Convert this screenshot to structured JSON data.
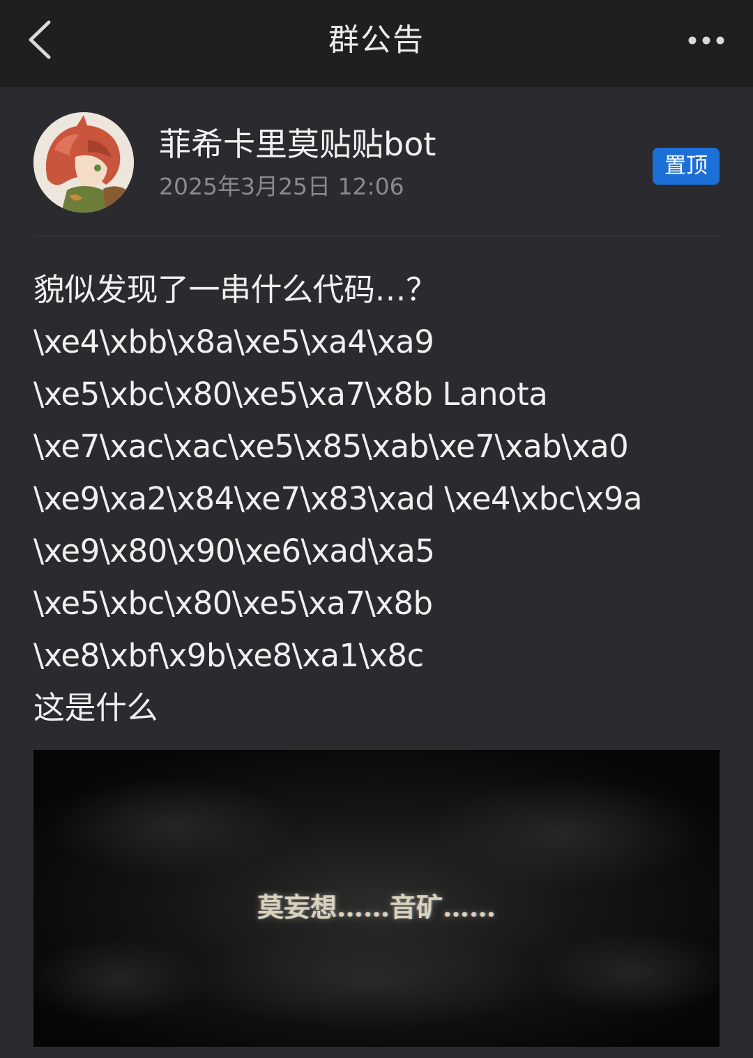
{
  "header": {
    "title": "群公告",
    "back_icon": "chevron-left-icon",
    "more_icon": "more-horizontal-icon"
  },
  "post": {
    "author": "菲希卡里莫贴贴bot",
    "time": "2025年3月25日 12:06",
    "pin_label": "置顶",
    "lines": [
      "貌似发现了一串什么代码…？",
      "\\xe4\\xbb\\x8a\\xe5\\xa4\\xa9",
      "\\xe5\\xbc\\x80\\xe5\\xa7\\x8b Lanota",
      "\\xe7\\xac\\xac\\xe5\\x85\\xab\\xe7\\xab\\xa0",
      "\\xe9\\xa2\\x84\\xe7\\x83\\xad \\xe4\\xbc\\x9a",
      "\\xe9\\x80\\x90\\xe6\\xad\\xa5",
      "\\xe5\\xbc\\x80\\xe5\\xa7\\x8b",
      "\\xe8\\xbf\\x9b\\xe8\\xa1\\x8c",
      "这是什么"
    ],
    "image_caption": "莫妄想……音矿……"
  },
  "colors": {
    "header_bg": "#1f1f21",
    "page_bg": "#2b2b2f",
    "pin_badge": "#1d6fd8",
    "time_text": "#8a8a8e"
  }
}
